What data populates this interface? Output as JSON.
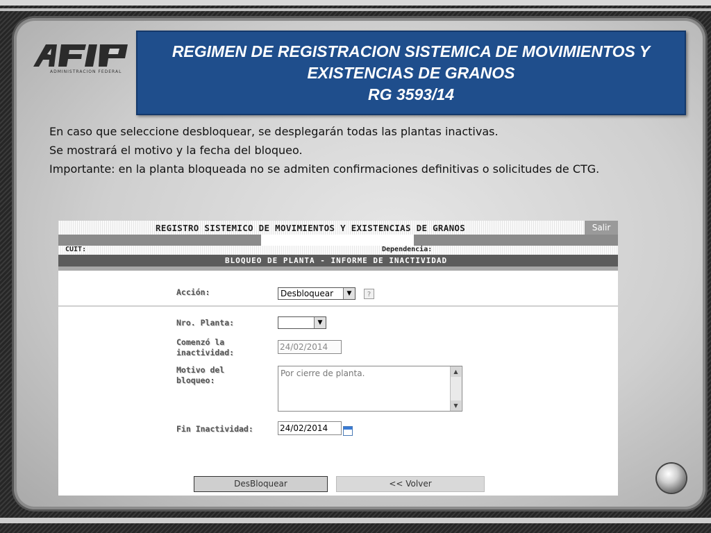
{
  "slide": {
    "logo_text": "AFIP",
    "logo_subtitle": "ADMINISTRACION FEDERAL",
    "title_lines": [
      "REGIMEN DE REGISTRACION SISTEMICA DE MOVIMIENTOS Y",
      "EXISTENCIAS DE GRANOS",
      "RG  3593/14"
    ],
    "description": [
      "En caso que seleccione desbloquear, se desplegarán todas las plantas inactivas.",
      "Se mostrará el motivo y la fecha del bloqueo.",
      "Importante: en la planta bloqueada no se admiten confirmaciones definitivas o solicitudes de CTG."
    ]
  },
  "app": {
    "header_title": "REGISTRO SISTEMICO DE MOVIMIENTOS Y EXISTENCIAS DE GRANOS",
    "salir_label": "Salir",
    "cuit_label": "CUIT:",
    "dependencia_label": "Dependencia:",
    "section_title": "BLOQUEO DE PLANTA - INFORME DE INACTIVIDAD",
    "form": {
      "accion_label": "Acción:",
      "accion_value": "Desbloquear",
      "help_label": "?",
      "nro_planta_label": "Nro. Planta:",
      "nro_planta_value": "",
      "comenzo_label_1": "Comenzó la",
      "comenzo_label_2": "inactividad:",
      "comenzo_value": "24/02/2014",
      "motivo_label_1": "Motivo del",
      "motivo_label_2": "bloqueo:",
      "motivo_value": "Por cierre de planta.",
      "fin_label": "Fin Inactividad:",
      "fin_value": "24/02/2014"
    },
    "buttons": {
      "desbloquear": "DesBloquear",
      "volver": "<< Volver"
    }
  }
}
